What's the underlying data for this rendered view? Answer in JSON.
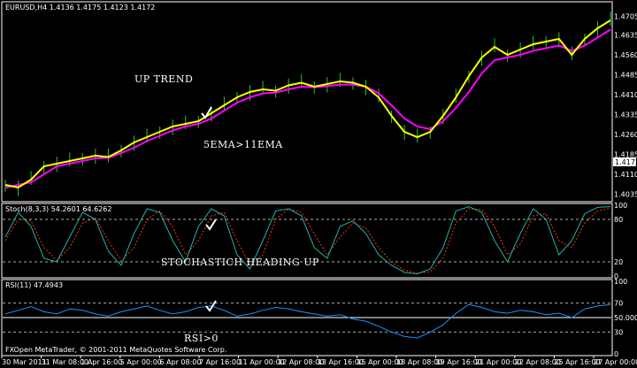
{
  "colors": {
    "background": "#000000",
    "panel_border": "#ffffff",
    "bar": "#22cc22",
    "ema5": "#ffff00",
    "ema11": "#ff00ff",
    "stoch_main": "#20b2aa",
    "stoch_signal": "#ff3300",
    "rsi": "#1e90ff",
    "level_line": "#aaaaaa",
    "price_tag_bg": "#ffffff",
    "price_tag_text": "#000000"
  },
  "chart_data": [
    {
      "type": "line",
      "title": "EURUSD,H4  1.4136 1.4175 1.4123 1.4172",
      "symbol": "EURUSD,H4",
      "ohlc_header": "1.4136 1.4175 1.4123 1.4172",
      "y_ticks": [
        "1.4705",
        "1.4635",
        "1.4560",
        "1.4485",
        "1.4410",
        "1.4335",
        "1.4260",
        "1.4185",
        "1.4110",
        "1.4035"
      ],
      "current_price": "1.4172",
      "ylim": [
        1.402,
        1.472
      ],
      "annotations": [
        "UP TREND",
        "5EMA>11EMA"
      ],
      "series": [
        {
          "values": [
            1.407,
            1.406,
            1.409,
            1.414,
            1.415,
            1.416,
            1.417,
            1.418,
            1.4175,
            1.42,
            1.423,
            1.425,
            1.427,
            1.429,
            1.43,
            1.431,
            1.434,
            1.437,
            1.44,
            1.442,
            1.443,
            1.4425,
            1.4445,
            1.4455,
            1.444,
            1.445,
            1.446,
            1.4455,
            1.444,
            1.44,
            1.433,
            1.427,
            1.425,
            1.427,
            1.433,
            1.44,
            1.448,
            1.455,
            1.459,
            1.456,
            1.458,
            1.46,
            1.461,
            1.462,
            1.456,
            1.462,
            1.466,
            1.469
          ]
        },
        {
          "values": [
            1.406,
            1.407,
            1.408,
            1.411,
            1.414,
            1.415,
            1.416,
            1.417,
            1.4172,
            1.419,
            1.421,
            1.4235,
            1.4255,
            1.4275,
            1.429,
            1.43,
            1.432,
            1.435,
            1.438,
            1.44,
            1.4415,
            1.4418,
            1.443,
            1.444,
            1.4438,
            1.4442,
            1.4448,
            1.4448,
            1.444,
            1.4415,
            1.437,
            1.432,
            1.429,
            1.428,
            1.431,
            1.436,
            1.442,
            1.449,
            1.454,
            1.455,
            1.456,
            1.4575,
            1.4585,
            1.4595,
            1.4575,
            1.4595,
            1.4625,
            1.4655
          ]
        }
      ]
    },
    {
      "type": "line",
      "title": "Stoch(8,3,3) 54.2601 64.6262",
      "y_ticks": [
        "100",
        "80",
        "20",
        "0"
      ],
      "levels": [
        80,
        20
      ],
      "ylim": [
        0,
        100
      ],
      "annotations": [
        "STOCHASTICH HEADING UP"
      ],
      "series": [
        {
          "values": [
            55,
            90,
            70,
            25,
            20,
            55,
            90,
            80,
            35,
            15,
            60,
            95,
            90,
            50,
            20,
            70,
            95,
            85,
            30,
            10,
            50,
            92,
            95,
            85,
            40,
            25,
            70,
            78,
            60,
            30,
            15,
            5,
            3,
            10,
            40,
            92,
            98,
            90,
            50,
            20,
            60,
            95,
            80,
            30,
            50,
            88,
            97,
            98
          ]
        },
        {
          "values": [
            50,
            80,
            78,
            40,
            22,
            40,
            75,
            82,
            50,
            22,
            40,
            80,
            92,
            70,
            30,
            50,
            85,
            90,
            50,
            15,
            30,
            80,
            95,
            90,
            60,
            30,
            55,
            75,
            68,
            40,
            20,
            8,
            4,
            6,
            25,
            75,
            95,
            94,
            70,
            30,
            45,
            85,
            88,
            50,
            40,
            75,
            92,
            96
          ]
        }
      ]
    },
    {
      "type": "line",
      "title": "RSI(11) 47.4943",
      "y_ticks": [
        "100",
        "70",
        "50.0000",
        "30",
        "0"
      ],
      "levels": [
        70,
        50,
        30
      ],
      "ylim": [
        0,
        100
      ],
      "annotations": [
        "RSI>0"
      ],
      "x_ticks": [
        "30 Mar 2011",
        "31 Mar 08:00",
        "1 Apr 16:00",
        "5 Apr 00:00",
        "6 Apr 08:00",
        "7 Apr 16:00",
        "11 Apr 00:00",
        "12 Apr 08:00",
        "13 Apr 16:00",
        "15 Apr 00:00",
        "18 Apr 08:00",
        "19 Apr 16:00",
        "21 Apr 00:00",
        "22 Apr 08:00",
        "25 Apr 16:00",
        "27 Apr 00:00"
      ],
      "series": [
        {
          "values": [
            55,
            60,
            65,
            58,
            55,
            62,
            60,
            55,
            52,
            58,
            62,
            66,
            60,
            55,
            58,
            64,
            66,
            60,
            52,
            55,
            60,
            64,
            62,
            58,
            55,
            52,
            54,
            48,
            45,
            38,
            30,
            24,
            22,
            30,
            40,
            56,
            68,
            64,
            58,
            56,
            60,
            58,
            54,
            56,
            50,
            62,
            66,
            68
          ]
        }
      ]
    }
  ],
  "footer": "FXOpen MetaTrader, © 2001-2011 MetaQuotes Software Corp."
}
